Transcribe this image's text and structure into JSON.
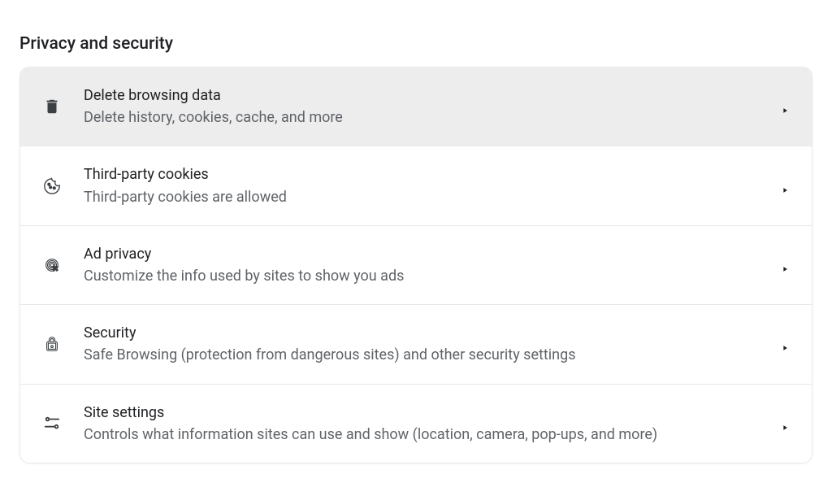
{
  "section": {
    "title": "Privacy and security",
    "items": [
      {
        "title": "Delete browsing data",
        "description": "Delete history, cookies, cache, and more",
        "icon": "trash-icon",
        "hovered": true
      },
      {
        "title": "Third-party cookies",
        "description": "Third-party cookies are allowed",
        "icon": "cookie-icon",
        "hovered": false
      },
      {
        "title": "Ad privacy",
        "description": "Customize the info used by sites to show you ads",
        "icon": "ad-click-icon",
        "hovered": false
      },
      {
        "title": "Security",
        "description": "Safe Browsing (protection from dangerous sites) and other security settings",
        "icon": "lock-icon",
        "hovered": false
      },
      {
        "title": "Site settings",
        "description": "Controls what information sites can use and show (location, camera, pop-ups, and more)",
        "icon": "tune-icon",
        "hovered": false
      }
    ]
  }
}
